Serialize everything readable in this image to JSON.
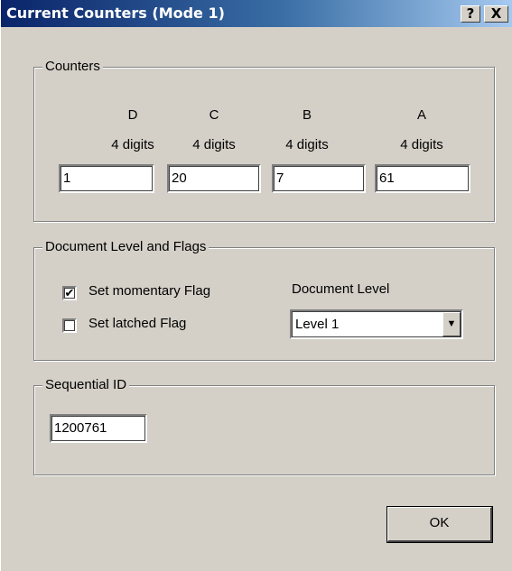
{
  "window": {
    "title": "Current Counters (Mode 1)",
    "help_button": "?",
    "close_button": "X"
  },
  "counters": {
    "group_label": "Counters",
    "columns": [
      {
        "letter": "D",
        "digits": "4 digits",
        "value": "1"
      },
      {
        "letter": "C",
        "digits": "4 digits",
        "value": "20"
      },
      {
        "letter": "B",
        "digits": "4 digits",
        "value": "7"
      },
      {
        "letter": "A",
        "digits": "4 digits",
        "value": "61"
      }
    ]
  },
  "flags": {
    "group_label": "Document Level and Flags",
    "momentary": {
      "label": "Set momentary Flag",
      "checked": true
    },
    "latched": {
      "label": "Set latched Flag",
      "checked": false
    },
    "level_label": "Document Level",
    "level_value": "Level 1"
  },
  "sequential": {
    "group_label": "Sequential ID",
    "value": "1200761"
  },
  "ok_button": "OK",
  "icons": {
    "check": "✔",
    "dropdown": "▼"
  }
}
